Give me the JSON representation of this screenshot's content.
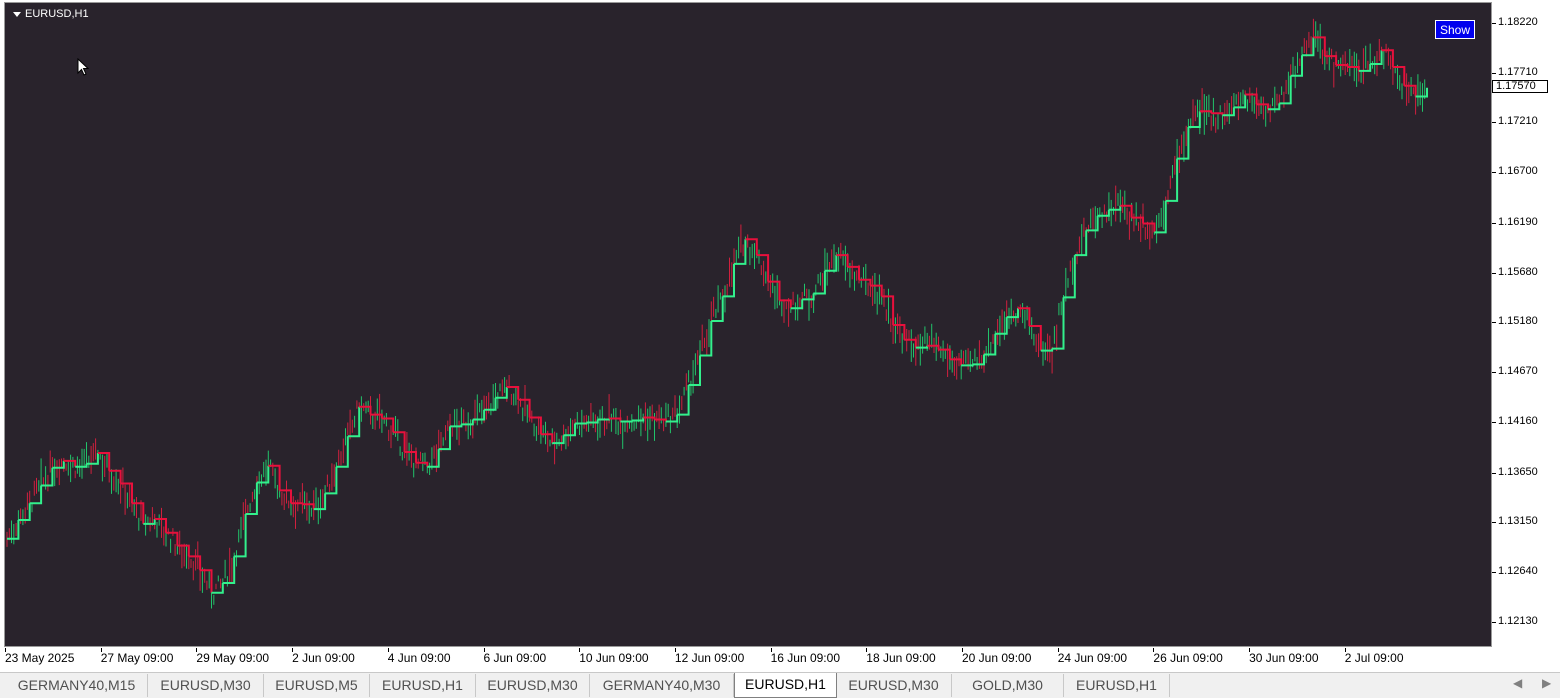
{
  "window": {
    "symbol_title": "EURUSD,H1",
    "show_button": "Show"
  },
  "colors": {
    "background": "#29232c",
    "bull_candle": "#21c36a",
    "bear_candle": "#d0203e",
    "trend_up": "#32f08c",
    "trend_down": "#e8103c"
  },
  "chart_data": {
    "type": "line",
    "symbol": "EURUSD",
    "timeframe": "H1",
    "ylim": [
      1.119,
      1.1845
    ],
    "current_price_label": "1.17570",
    "y_ticks": [
      "1.18220",
      "1.17710",
      "1.17210",
      "1.16700",
      "1.16190",
      "1.15680",
      "1.15180",
      "1.14670",
      "1.14160",
      "1.13650",
      "1.13150",
      "1.12640",
      "1.12130"
    ],
    "x_ticks": [
      "23 May 2025",
      "27 May 09:00",
      "29 May 09:00",
      "2 Jun 09:00",
      "4 Jun 09:00",
      "6 Jun 09:00",
      "10 Jun 09:00",
      "12 Jun 09:00",
      "16 Jun 09:00",
      "18 Jun 09:00",
      "20 Jun 09:00",
      "24 Jun 09:00",
      "26 Jun 09:00",
      "30 Jun 09:00",
      "2 Jul 09:00"
    ],
    "series": [
      {
        "values": [
          1.1299,
          1.1318,
          1.1335,
          1.1353,
          1.1371,
          1.1378,
          1.1372,
          1.1375,
          1.1386,
          1.1368,
          1.1355,
          1.1335,
          1.1314,
          1.1319,
          1.1305,
          1.1292,
          1.1281,
          1.1267,
          1.1244,
          1.1254,
          1.1281,
          1.1324,
          1.1356,
          1.1373,
          1.1348,
          1.1335,
          1.1334,
          1.1329,
          1.1345,
          1.1372,
          1.1403,
          1.1433,
          1.1425,
          1.1421,
          1.1407,
          1.1387,
          1.1376,
          1.1372,
          1.139,
          1.1413,
          1.1415,
          1.142,
          1.143,
          1.1442,
          1.1453,
          1.144,
          1.1422,
          1.1405,
          1.1396,
          1.1404,
          1.1416,
          1.1417,
          1.142,
          1.1421,
          1.1418,
          1.1419,
          1.1422,
          1.142,
          1.1418,
          1.1425,
          1.1455,
          1.1485,
          1.152,
          1.1545,
          1.1578,
          1.1603,
          1.1587,
          1.156,
          1.1541,
          1.1533,
          1.1542,
          1.1548,
          1.1571,
          1.1587,
          1.1575,
          1.1562,
          1.1556,
          1.1545,
          1.1516,
          1.1501,
          1.1493,
          1.1495,
          1.1491,
          1.1481,
          1.1475,
          1.1476,
          1.1486,
          1.1507,
          1.1524,
          1.1533,
          1.1515,
          1.149,
          1.1492,
          1.1544,
          1.1587,
          1.1612,
          1.1627,
          1.1633,
          1.1637,
          1.1625,
          1.1619,
          1.161,
          1.1642,
          1.1685,
          1.1717,
          1.1733,
          1.1731,
          1.1729,
          1.1737,
          1.175,
          1.174,
          1.1735,
          1.1741,
          1.1769,
          1.179,
          1.1808,
          1.1789,
          1.178,
          1.1778,
          1.1774,
          1.1781,
          1.1795,
          1.1778,
          1.1759,
          1.1748,
          1.1757
        ]
      }
    ]
  },
  "tabs": [
    {
      "label": "GERMANY40,M15"
    },
    {
      "label": "EURUSD,M30"
    },
    {
      "label": "EURUSD,M5"
    },
    {
      "label": "EURUSD,H1"
    },
    {
      "label": "EURUSD,M30"
    },
    {
      "label": "GERMANY40,M30"
    },
    {
      "label": "EURUSD,H1",
      "active": true
    },
    {
      "label": "EURUSD,M30"
    },
    {
      "label": "GOLD,M30"
    },
    {
      "label": "EURUSD,H1"
    }
  ]
}
